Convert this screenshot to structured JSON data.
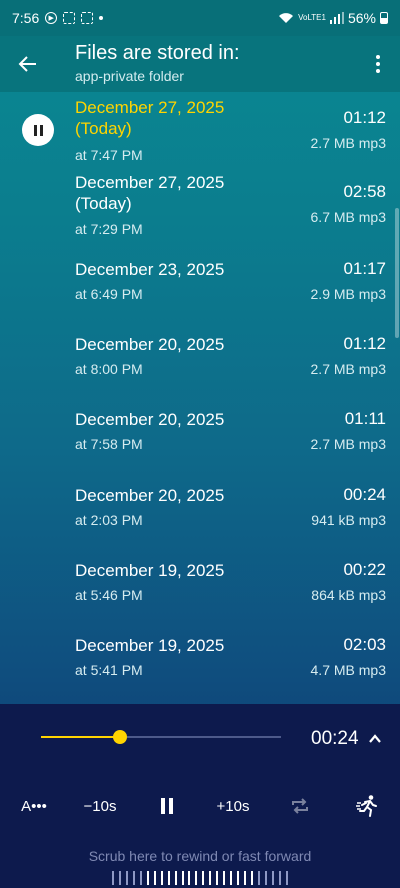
{
  "status_bar": {
    "time": "7:56",
    "network": "VoLTE1",
    "battery": "56%"
  },
  "header": {
    "title": "Files are stored in:",
    "subtitle": "app-private folder"
  },
  "recordings": [
    {
      "date": "December 27, 2025",
      "today": "(Today)",
      "time": "at 7:47 PM",
      "duration": "01:12",
      "size": "2.7 MB mp3",
      "active": true
    },
    {
      "date": "December 27, 2025",
      "today": "(Today)",
      "time": "at 7:29 PM",
      "duration": "02:58",
      "size": "6.7 MB mp3"
    },
    {
      "date": "December 23, 2025",
      "time": "at 6:49 PM",
      "duration": "01:17",
      "size": "2.9 MB mp3"
    },
    {
      "date": "December 20, 2025",
      "time": "at 8:00 PM",
      "duration": "01:12",
      "size": "2.7 MB mp3"
    },
    {
      "date": "December 20, 2025",
      "time": "at 7:58 PM",
      "duration": "01:11",
      "size": "2.7 MB mp3"
    },
    {
      "date": "December 20, 2025",
      "time": "at 2:03 PM",
      "duration": "00:24",
      "size": "941 kB mp3"
    },
    {
      "date": "December 19, 2025",
      "time": "at 5:46 PM",
      "duration": "00:22",
      "size": "864 kB mp3"
    },
    {
      "date": "December 19, 2025",
      "time": "at 5:41 PM",
      "duration": "02:03",
      "size": "4.7 MB mp3"
    }
  ],
  "player": {
    "progress_fraction": 0.33,
    "elapsed": "00:24",
    "speed_label": "A•••",
    "rewind_label": "−10s",
    "forward_label": "+10s",
    "scrub_hint": "Scrub here to rewind or fast forward"
  },
  "colors": {
    "accent": "#ffd400",
    "player_bg": "#0d1a4d"
  }
}
